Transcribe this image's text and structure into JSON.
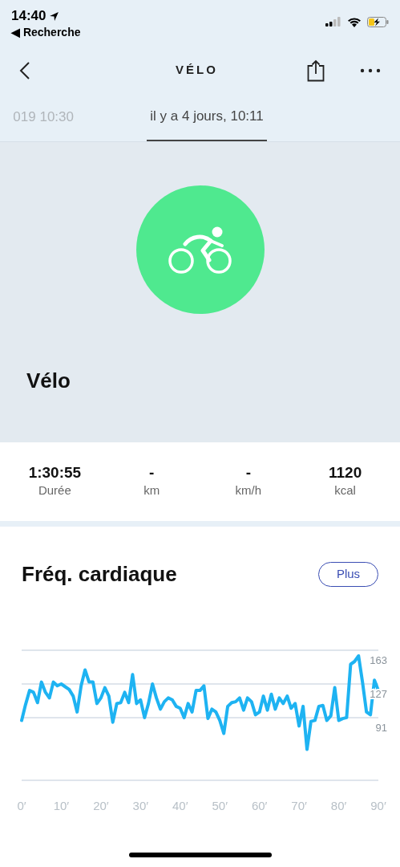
{
  "status_bar": {
    "time": "14:40",
    "back_link": "◀ Recherche"
  },
  "header": {
    "title": "VÉLO"
  },
  "tabs": [
    {
      "label": "019 10:30",
      "selected": false
    },
    {
      "label": "il y a 4 jours, 10:11",
      "selected": true
    }
  ],
  "activity": {
    "name": "Vélo"
  },
  "stats": [
    {
      "value": "1:30:55",
      "label": "Durée"
    },
    {
      "value": "-",
      "label": "km"
    },
    {
      "value": "-",
      "label": "km/h"
    },
    {
      "value": "1120",
      "label": "kcal"
    }
  ],
  "heart_rate": {
    "title": "Fréq. cardiaque",
    "button": "Plus",
    "chart_data": {
      "type": "line",
      "x": [
        0,
        1,
        2,
        3,
        4,
        5,
        6,
        7,
        8,
        9,
        10,
        11,
        12,
        13,
        14,
        15,
        16,
        17,
        18,
        19,
        20,
        21,
        22,
        23,
        24,
        25,
        26,
        27,
        28,
        29,
        30,
        31,
        32,
        33,
        34,
        35,
        36,
        37,
        38,
        39,
        40,
        41,
        42,
        43,
        44,
        45,
        46,
        47,
        48,
        49,
        50,
        51,
        52,
        53,
        54,
        55,
        56,
        57,
        58,
        59,
        60,
        61,
        62,
        63,
        64,
        65,
        66,
        67,
        68,
        69,
        70,
        71,
        72,
        73,
        74,
        75,
        76,
        77,
        78,
        79,
        80,
        81,
        82,
        83,
        84,
        85,
        86,
        87,
        88,
        89,
        90
      ],
      "series": [
        {
          "color": "#1eb3f2",
          "values": [
            88,
            105,
            120,
            118,
            107,
            129,
            118,
            112,
            129,
            125,
            127,
            124,
            121,
            114,
            97,
            125,
            142,
            129,
            129,
            106,
            112,
            123,
            114,
            86,
            106,
            107,
            118,
            107,
            137,
            106,
            110,
            91,
            106,
            127,
            112,
            100,
            108,
            112,
            110,
            103,
            101,
            91,
            106,
            97,
            120,
            120,
            125,
            90,
            100,
            97,
            88,
            74,
            103,
            107,
            108,
            112,
            99,
            112,
            108,
            94,
            97,
            114,
            99,
            116,
            100,
            112,
            106,
            114,
            101,
            106,
            82,
            103,
            57,
            87,
            88,
            103,
            104,
            88,
            93,
            123,
            88,
            90,
            91,
            148,
            151,
            157,
            129,
            97,
            94,
            131,
            120
          ]
        }
      ],
      "xlim": [
        0,
        90
      ],
      "ylim": [
        24,
        163
      ],
      "xticks": [
        {
          "value": 0,
          "label": "0′"
        },
        {
          "value": 10,
          "label": "10′"
        },
        {
          "value": 20,
          "label": "20′"
        },
        {
          "value": 30,
          "label": "30′"
        },
        {
          "value": 40,
          "label": "40′"
        },
        {
          "value": 50,
          "label": "50′"
        },
        {
          "value": 60,
          "label": "60′"
        },
        {
          "value": 70,
          "label": "70′"
        },
        {
          "value": 80,
          "label": "80′"
        },
        {
          "value": 90,
          "label": "90′"
        }
      ],
      "yticks": [
        163,
        127,
        91
      ]
    }
  }
}
